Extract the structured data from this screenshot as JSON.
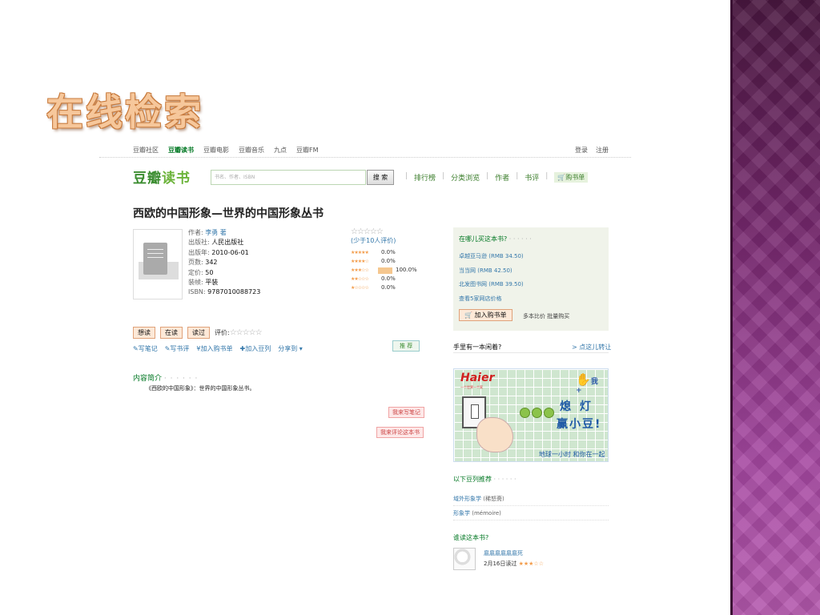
{
  "slide": {
    "title": "在线检索"
  },
  "site": {
    "topnav": [
      "豆瓣社区",
      "豆瓣读书",
      "豆瓣电影",
      "豆瓣音乐",
      "九点",
      "豆瓣FM"
    ],
    "login": "登录",
    "register": "注册",
    "logo_a": "豆瓣",
    "logo_b": "读书",
    "search_placeholder": "书名、作者、ISBN",
    "search_button": "搜 索",
    "mainnav": [
      "排行榜",
      "分类浏览",
      "作者",
      "书评"
    ],
    "cart_link": "购书单"
  },
  "book": {
    "title": "西欧的中国形象—世界的中国形象丛书",
    "author_label": "作者:",
    "author": "李勇 著",
    "publisher_label": "出版社:",
    "publisher": "人民出版社",
    "pubdate_label": "出版年:",
    "pubdate": "2010-06-01",
    "pages_label": "页数:",
    "pages": "342",
    "price_label": "定价:",
    "price": "50",
    "binding_label": "装帧:",
    "binding": "平装",
    "isbn_label": "ISBN:",
    "isbn": "9787010088723",
    "rating_stars": "☆☆☆☆☆",
    "rating_count": "(少于10人评价)",
    "rating_rows": [
      {
        "stars": "★★★★★",
        "pct": "0.0%",
        "value": 0
      },
      {
        "stars": "★★★★☆",
        "pct": "0.0%",
        "value": 0
      },
      {
        "stars": "★★★☆☆",
        "pct": "100.0%",
        "value": 100
      },
      {
        "stars": "★★☆☆☆",
        "pct": "0.0%",
        "value": 0
      },
      {
        "stars": "★☆☆☆☆",
        "pct": "0.0%",
        "value": 0
      }
    ]
  },
  "actions": {
    "want": "想读",
    "reading": "在读",
    "read": "读过",
    "rate_label": "评价:",
    "rate_stars": "☆☆☆☆☆",
    "note": "写笔记",
    "review": "写书评",
    "add_cart": "加入购书单",
    "add_list": "加入豆列",
    "share": "分享到",
    "recommend": "推 荐"
  },
  "intro": {
    "heading": "内容简介",
    "dots": "· · · · · ·",
    "text": "《西欧的中国形象》：世界的中国形象丛书。",
    "note_btn": "我来写笔记",
    "review_btn": "我来评论这本书"
  },
  "buy": {
    "heading": "在哪儿买这本书?",
    "dots": "· · · · · ·",
    "stores": [
      {
        "name": "卓越亚马逊",
        "price": "(RMB 34.50)"
      },
      {
        "name": "当当网",
        "price": "(RMB 42.50)"
      },
      {
        "name": "北发图书网",
        "price": "(RMB 39.50)"
      }
    ],
    "more": "查看5家网店价格",
    "cart_btn": "加入购书单",
    "compare": "多本比价 批量购买"
  },
  "idle": {
    "left": "手里有一本闲着?",
    "right": "> 点这儿转让"
  },
  "ad": {
    "brand": "Haier",
    "brand_sub": "一个世界一个家",
    "logo2": "我+",
    "t1": "熄 灯",
    "t2": "赢小豆!",
    "t3": "地球一小时 和你在一起"
  },
  "lists": {
    "heading": "以下豆列推荐",
    "dots": "· · · · · ·",
    "items": [
      {
        "name": "域外形象学",
        "meta": "(稀怒斋)"
      },
      {
        "name": "形象学",
        "meta": "(mémoire)"
      }
    ]
  },
  "readers": {
    "heading": "谁读这本书?",
    "name": "扈扈扈扈扈扈死",
    "date": "2月16日读过",
    "stars": "★★★☆☆"
  },
  "colors": {
    "accent_green": "#3a8c2f",
    "link_blue": "#3377aa",
    "star_orange": "#f39c4a",
    "title_orange": "#f6c79b",
    "strip_purple": "#a648a2"
  }
}
